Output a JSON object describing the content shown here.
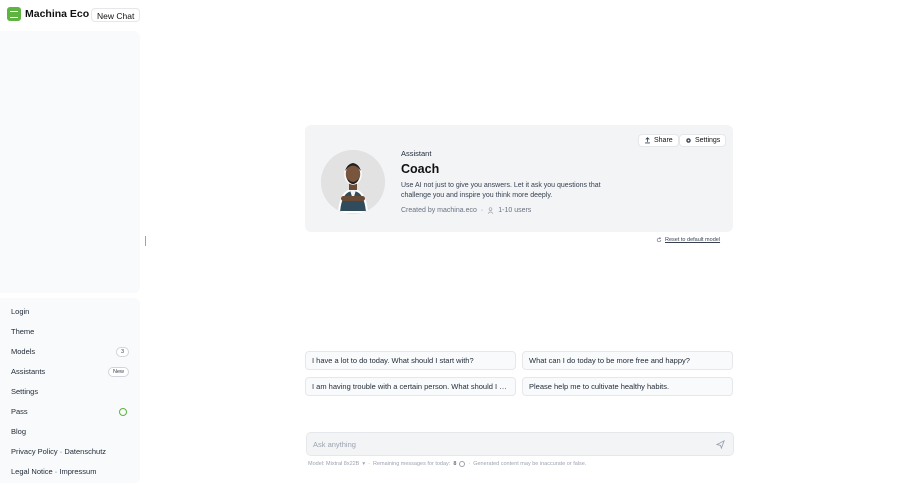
{
  "brand": {
    "name": "Machina Eco",
    "accent": "#5fb340"
  },
  "header": {
    "new_chat_label": "New Chat"
  },
  "sidebar": {
    "items": [
      {
        "label": "Login"
      },
      {
        "label": "Theme"
      },
      {
        "label": "Models",
        "badge": "3"
      },
      {
        "label": "Assistants",
        "badge": "New"
      },
      {
        "label": "Settings"
      },
      {
        "label": "Pass",
        "icon": "check-circle-icon"
      },
      {
        "label": "Blog"
      },
      {
        "label": "Privacy Policy · Datenschutz"
      },
      {
        "label": "Legal Notice · Impressum"
      }
    ]
  },
  "assistant_card": {
    "share_label": "Share",
    "settings_label": "Settings",
    "kicker": "Assistant",
    "name": "Coach",
    "description": "Use AI not just to give you answers. Let it ask you questions that challenge you and inspire you think more deeply.",
    "created_by": "Created by machina.eco",
    "users": "1-10 users"
  },
  "reset_label": "Reset to default model",
  "suggestions": [
    "I have a lot to do today. What should I start with?",
    "What can I do today to be more free and happy?",
    "I am having trouble with a certain person. What should I do?",
    "Please help me to cultivate healthy habits."
  ],
  "composer": {
    "placeholder": "Ask anything"
  },
  "footer": {
    "model": "Model: Mixtral 8x22B",
    "remaining_label": "Remaining messages for today:",
    "remaining_count": "8",
    "disclaimer": "Generated content may be inaccurate or false."
  }
}
